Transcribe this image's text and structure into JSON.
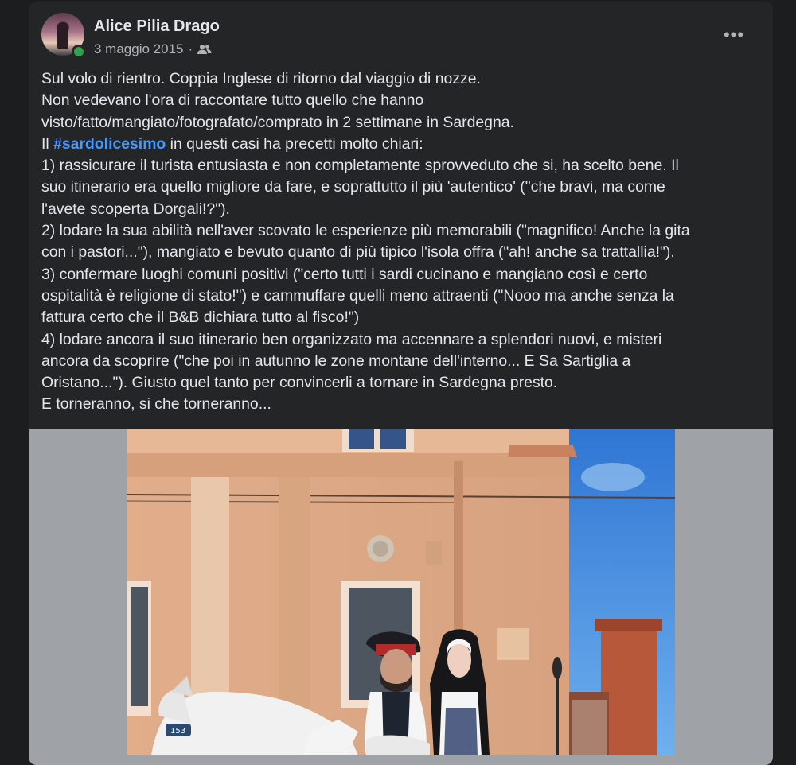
{
  "post": {
    "author": "Alice Pilia Drago",
    "date": "3 maggio 2015",
    "separator": "·",
    "audience_icon": "friends-icon",
    "more_icon": "more-options-icon",
    "more_label": "•••",
    "lines": [
      "Sul volo di rientro. Coppia Inglese di ritorno dal viaggio di nozze.",
      "Non vedevano l'ora di raccontare tutto quello che hanno",
      "visto/fatto/mangiato/fotografato/comprato in 2 settimane in Sardegna."
    ],
    "hashtag_prefix": "Il ",
    "hashtag": "#sardolicesimo",
    "hashtag_suffix": " in questi casi ha precetti molto chiari:",
    "lines2": [
      "1) rassicurare il turista entusiasta e non completamente sprovveduto che si, ha scelto bene. Il",
      "suo itinerario era quello migliore da fare, e soprattutto il più 'autentico' (\"che bravi, ma come",
      "l'avete scoperta Dorgali!?\").",
      "2) lodare la sua abilità nell'aver scovato le esperienze più memorabili (\"magnifico! Anche la gita",
      "con i pastori...\"), mangiato e bevuto quanto di più tipico l'isola offra (\"ah! anche sa trattallia!\").",
      "3) confermare luoghi comuni positivi (\"certo tutti i sardi cucinano e mangiano così e certo",
      "ospitalità è religione di stato!\") e cammuffare quelli meno attraenti (\"Nooo ma anche senza la",
      "fattura certo che il B&B dichiara tutto al fisco!\")",
      "4) lodare ancora il suo itinerario ben organizzato ma accennare a splendori nuovi, e misteri",
      "ancora da scoprire (\"che poi in autunno le zone montane dell'interno... E Sa Sartiglia a",
      "Oristano...\"). Giusto quel tanto per convincerli a tornare in Sardegna presto.",
      "E torneranno, si che torneranno..."
    ],
    "photo_badge": "153"
  }
}
